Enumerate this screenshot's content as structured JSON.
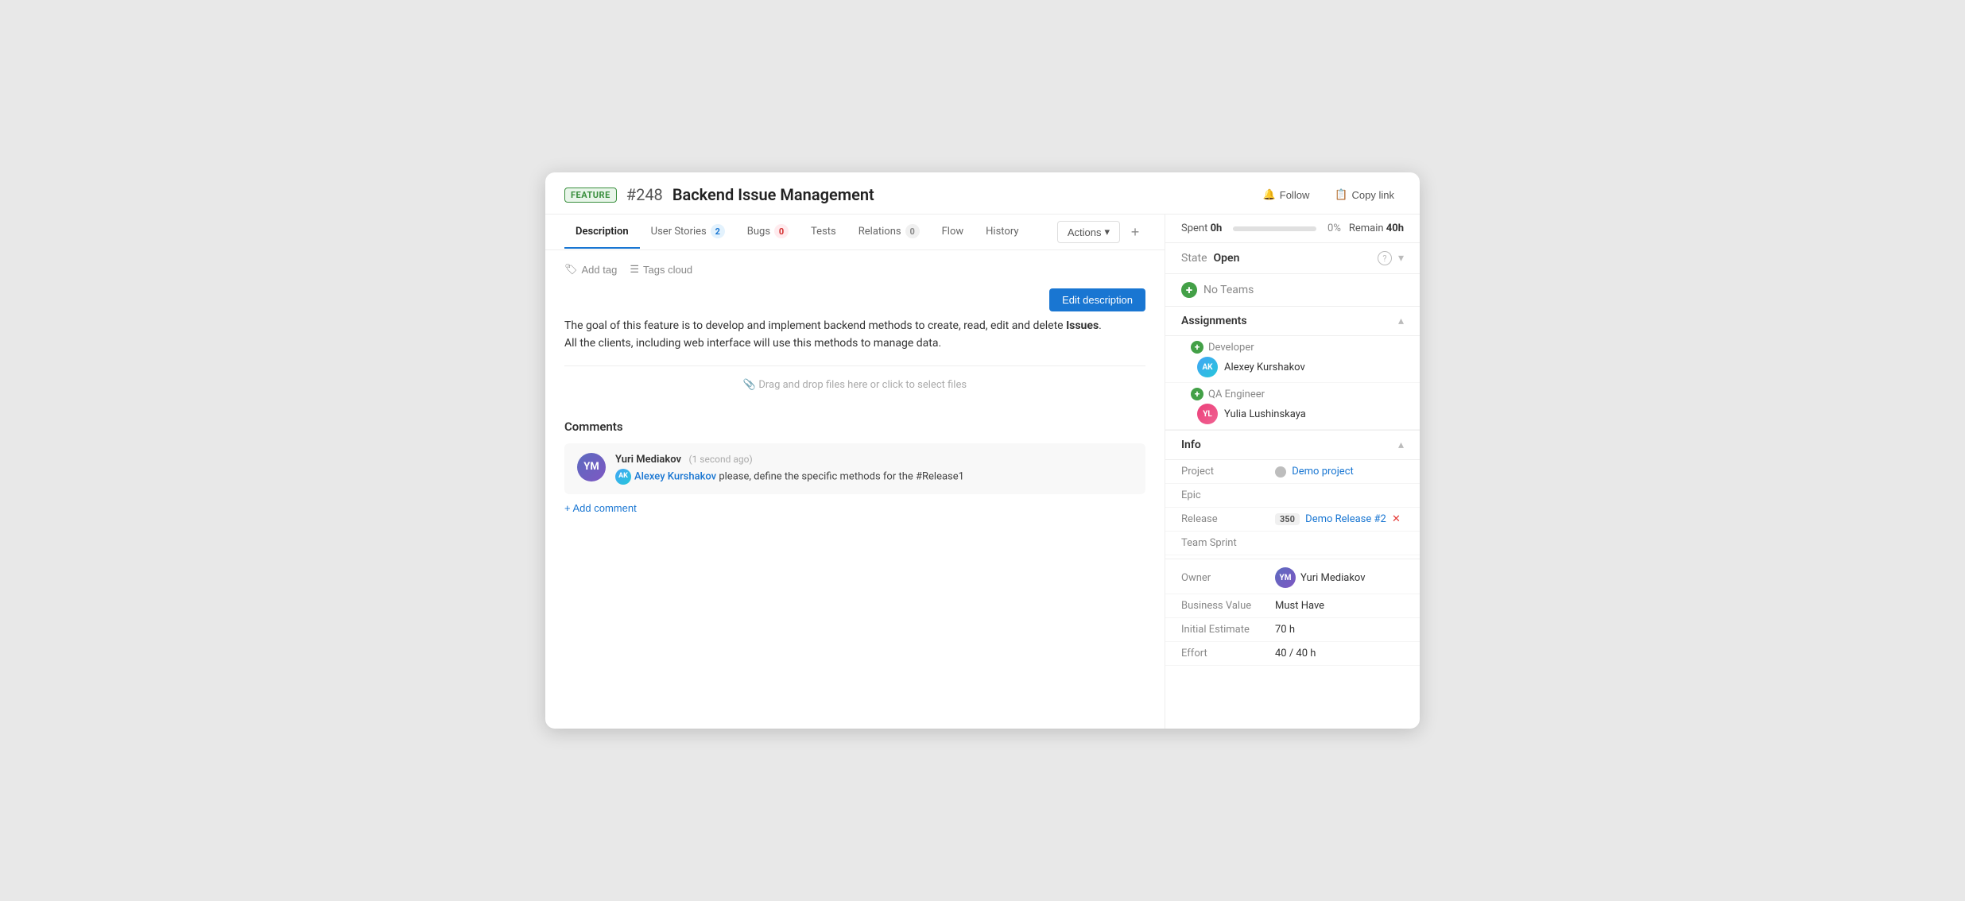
{
  "window": {
    "feature_badge": "FEATURE",
    "issue_number": "#248",
    "issue_title": "Backend Issue Management"
  },
  "header_actions": {
    "follow_label": "Follow",
    "copy_link_label": "Copy link"
  },
  "tabs": [
    {
      "id": "description",
      "label": "Description",
      "active": true,
      "badge": null
    },
    {
      "id": "user-stories",
      "label": "User Stories",
      "active": false,
      "badge": "2",
      "badge_type": "blue"
    },
    {
      "id": "bugs",
      "label": "Bugs",
      "active": false,
      "badge": "0",
      "badge_type": "red"
    },
    {
      "id": "tests",
      "label": "Tests",
      "active": false,
      "badge": null
    },
    {
      "id": "relations",
      "label": "Relations",
      "active": false,
      "badge": "0",
      "badge_type": "gray"
    },
    {
      "id": "flow",
      "label": "Flow",
      "active": false,
      "badge": null
    },
    {
      "id": "history",
      "label": "History",
      "active": false,
      "badge": null
    }
  ],
  "toolbar": {
    "actions_label": "Actions",
    "add_label": "+"
  },
  "tag_controls": {
    "add_tag_label": "Add tag",
    "tags_cloud_label": "Tags cloud"
  },
  "description": {
    "edit_btn_label": "Edit description",
    "text_line1": "The goal of this feature is to develop and implement backend methods to create, read, edit and delete ",
    "text_bold": "Issues",
    "text_line1_end": ".",
    "text_line2": "All the clients, including web interface will use this methods to manage data."
  },
  "dropzone": {
    "label": "Drag and drop files here or click to select files"
  },
  "comments": {
    "section_title": "Comments",
    "add_comment_label": "+ Add comment",
    "items": [
      {
        "id": 1,
        "author": "Yuri Mediakov",
        "time": "1 second ago",
        "mention": "Alexey Kurshakov",
        "text_after": " please, define the specific methods for the #Release1",
        "author_initials": "YM",
        "mention_initials": "AK"
      }
    ]
  },
  "right_panel": {
    "progress": {
      "spent_label": "Spent",
      "spent_value": "0h",
      "pct": "0%",
      "remain_label": "Remain",
      "remain_value": "40h"
    },
    "state": {
      "label": "State",
      "value": "Open"
    },
    "teams": {
      "label": "No Teams"
    },
    "assignments": {
      "title": "Assignments",
      "items": [
        {
          "role": "Developer",
          "person": "Alexey Kurshakov",
          "initials": "AK",
          "color": "#42a5f5"
        },
        {
          "role": "QA Engineer",
          "person": "Yulia Lushinskaya",
          "initials": "YL",
          "color": "#ec407a"
        }
      ]
    },
    "info": {
      "title": "Info",
      "rows": [
        {
          "key": "Project",
          "val": "Demo project",
          "type": "link"
        },
        {
          "key": "Epic",
          "val": "",
          "type": "text"
        },
        {
          "key": "Release",
          "val": "Demo Release #2",
          "type": "release",
          "badge": "350"
        },
        {
          "key": "Team Sprint",
          "val": "",
          "type": "text"
        },
        {
          "key": "Owner",
          "val": "Yuri Mediakov",
          "type": "owner",
          "initials": "YM"
        },
        {
          "key": "Business Value",
          "val": "Must Have",
          "type": "text"
        },
        {
          "key": "Initial Estimate",
          "val": "70 h",
          "type": "text"
        },
        {
          "key": "Effort",
          "val": "40 / 40 h",
          "type": "text"
        }
      ]
    }
  }
}
